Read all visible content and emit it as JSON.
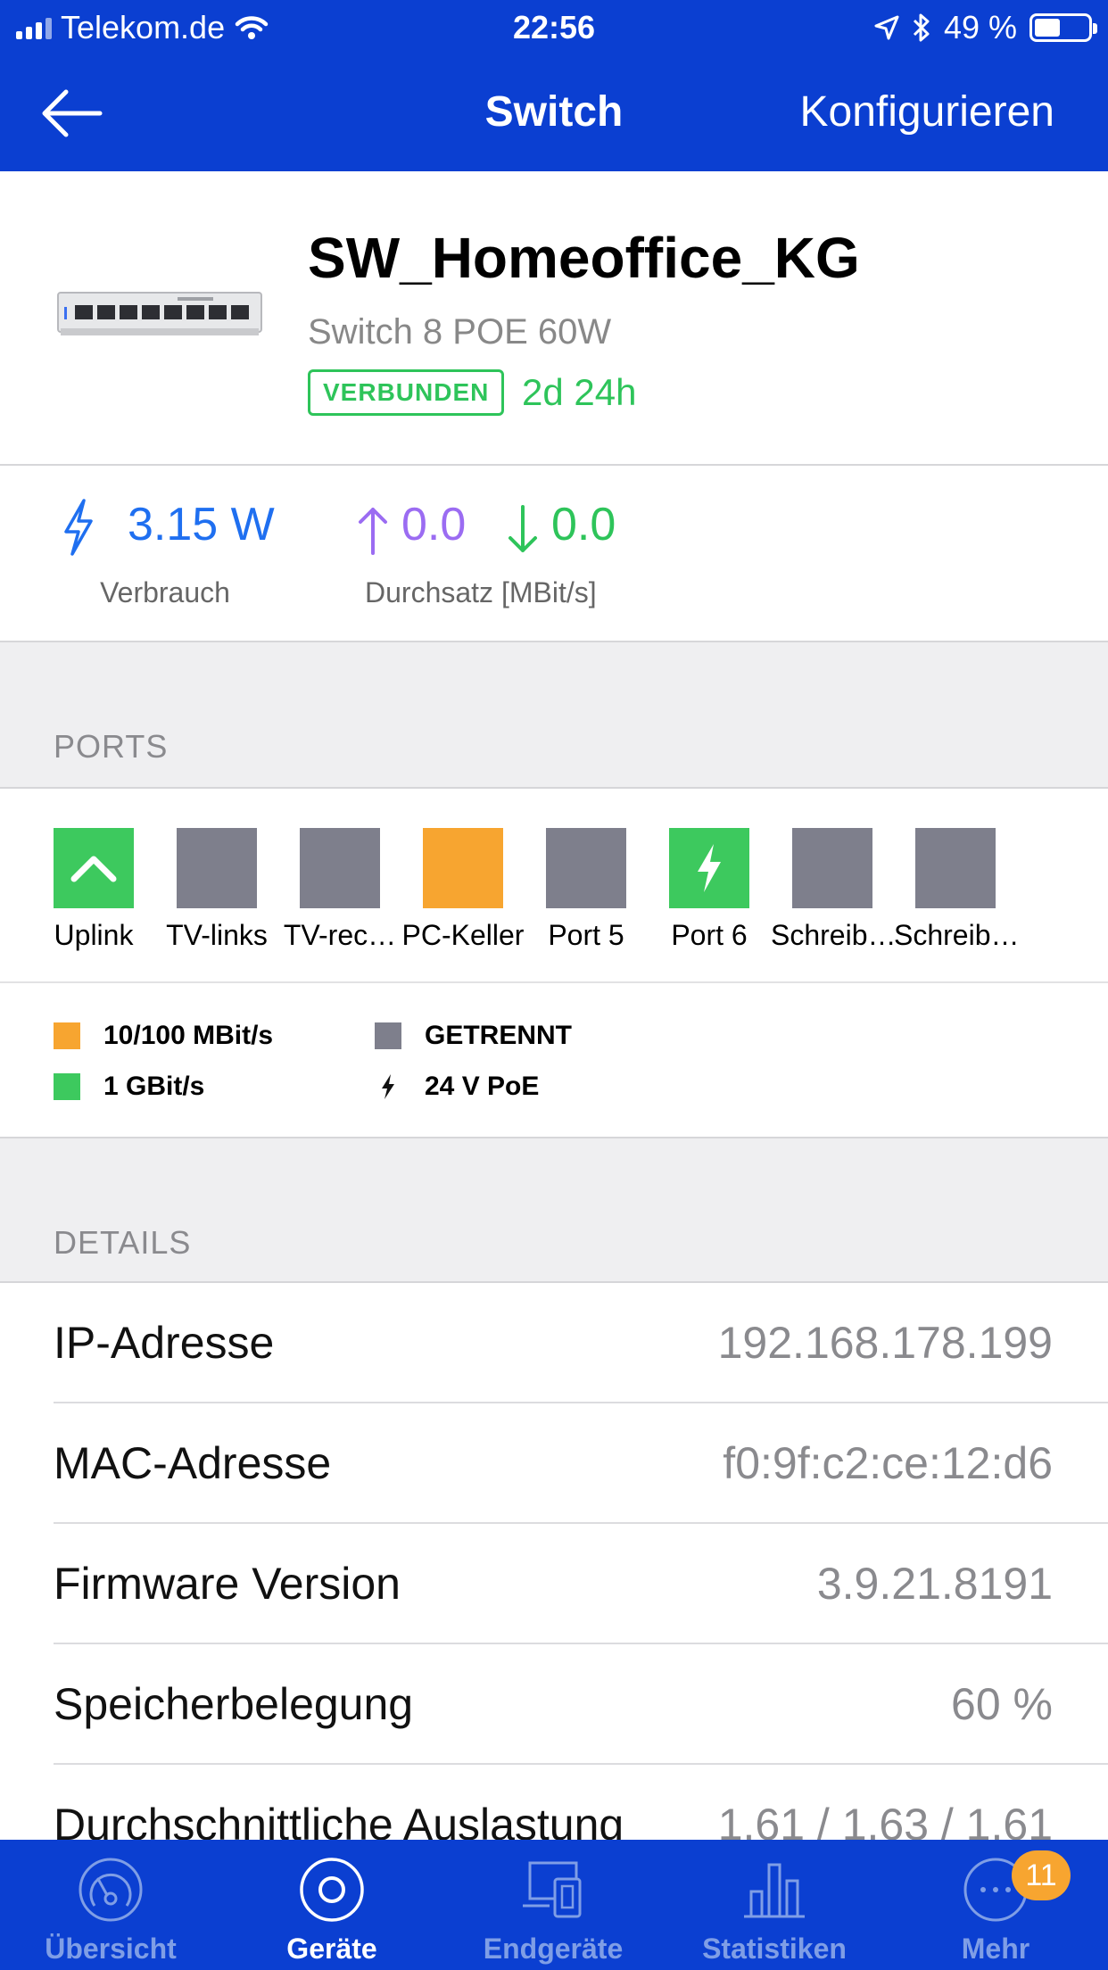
{
  "status_bar": {
    "carrier": "Telekom.de",
    "time": "22:56",
    "battery": "49 %",
    "battery_level": 0.49
  },
  "nav": {
    "title": "Switch",
    "action_label": "Konfigurieren"
  },
  "device": {
    "name": "SW_Homeoffice_KG",
    "model": "Switch 8 POE 60W",
    "status": "VERBUNDEN",
    "uptime": "2d 24h"
  },
  "stats": {
    "power_value": "3.15 W",
    "power_label": "Verbrauch",
    "upload_value": "0.0",
    "download_value": "0.0",
    "throughput_label": "Durchsatz [MBit/s]"
  },
  "ports": {
    "section_title": "PORTS",
    "items": [
      {
        "label": "Uplink",
        "state": "1gbit-uplink",
        "color": "#3dc95e"
      },
      {
        "label": "TV-links",
        "state": "disconnected",
        "color": "#7e7f8c"
      },
      {
        "label": "TV-rec…",
        "state": "disconnected",
        "color": "#7e7f8c"
      },
      {
        "label": "PC-Keller",
        "state": "10-100",
        "color": "#f7a530"
      },
      {
        "label": "Port 5",
        "state": "disconnected",
        "color": "#7e7f8c"
      },
      {
        "label": "Port 6",
        "state": "1gbit-poe",
        "color": "#3dc95e"
      },
      {
        "label": "Schreib…",
        "state": "disconnected",
        "color": "#7e7f8c"
      },
      {
        "label": "Schreib…",
        "state": "disconnected",
        "color": "#7e7f8c"
      }
    ],
    "legend": {
      "speed_100": "10/100 MBit/s",
      "speed_1g": "1 GBit/s",
      "disconnected": "GETRENNT",
      "poe": "24 V PoE"
    }
  },
  "details": {
    "section_title": "DETAILS",
    "rows": [
      {
        "label": "IP-Adresse",
        "value": "192.168.178.199"
      },
      {
        "label": "MAC-Adresse",
        "value": "f0:9f:c2:ce:12:d6"
      },
      {
        "label": "Firmware Version",
        "value": "3.9.21.8191"
      },
      {
        "label": "Speicherbelegung",
        "value": "60 %"
      },
      {
        "label": "Durchschnittliche Auslastung",
        "value": "1.61 / 1.63 / 1.61"
      }
    ]
  },
  "tabbar": {
    "items": [
      {
        "label": "Übersicht"
      },
      {
        "label": "Geräte"
      },
      {
        "label": "Endgeräte"
      },
      {
        "label": "Statistiken"
      },
      {
        "label": "Mehr",
        "badge": "11"
      }
    ]
  },
  "colors": {
    "brand": "#0b3fd1",
    "connected": "#2ec45a",
    "power": "#1f6ff0",
    "upload": "#9b6cf2",
    "orange": "#f7a530",
    "gray_port": "#7e7f8c"
  }
}
